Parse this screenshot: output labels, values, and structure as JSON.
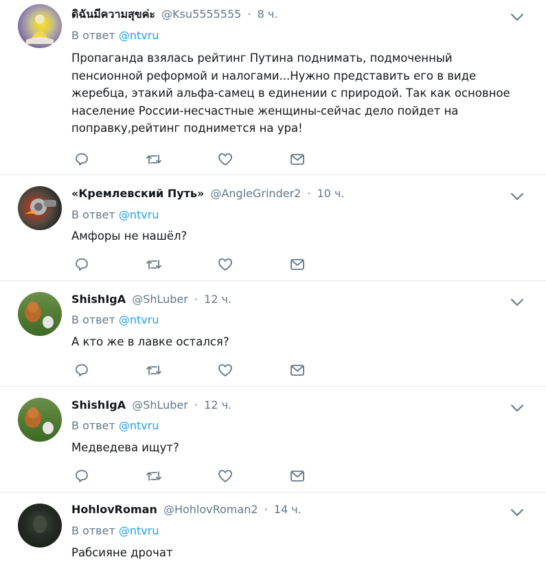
{
  "tweets": [
    {
      "name": "ดิฉันมีความสุขค่ะ",
      "handle": "@Ksu5555555",
      "dot": "·",
      "time": "8 ч.",
      "reply_prefix": "В ответ",
      "reply_to": "@ntvru",
      "text": "Пропаганда взялась рейтинг Путина поднимать, подмоченный пенсионной реформой и налогами...Нужно представить его в виде жеребца, этакий альфа-самец в единении с природой. Так как основное население России-несчастные женщины-сейчас дело пойдет на поправку,рейтинг поднимется на ура!"
    },
    {
      "name": "«Кремлевский Путь»",
      "handle": "@AngleGrinder2",
      "dot": "·",
      "time": "10 ч.",
      "reply_prefix": "В ответ",
      "reply_to": "@ntvru",
      "text": "Амфоры не нашёл?"
    },
    {
      "name": "ShishIgA",
      "handle": "@ShLuber",
      "dot": "·",
      "time": "12 ч.",
      "reply_prefix": "В ответ",
      "reply_to": "@ntvru",
      "text": "А кто же в лавке остался?"
    },
    {
      "name": "ShishIgA",
      "handle": "@ShLuber",
      "dot": "·",
      "time": "12 ч.",
      "reply_prefix": "В ответ",
      "reply_to": "@ntvru",
      "text": "Медведева ищут?"
    },
    {
      "name": "HohlovRoman",
      "handle": "@HohlovRoman2",
      "dot": "·",
      "time": "14 ч.",
      "reply_prefix": "В ответ",
      "reply_to": "@ntvru",
      "text": "Рабсияне дрочат"
    }
  ],
  "icons": {
    "reply": "reply-icon",
    "retweet": "retweet-icon",
    "like": "heart-icon",
    "message": "envelope-icon",
    "caret": "chevron-down-icon"
  },
  "colors": {
    "link": "#1da1f2",
    "secondary_text": "#657786",
    "icon": "#657786",
    "divider": "#e6ecf0"
  }
}
